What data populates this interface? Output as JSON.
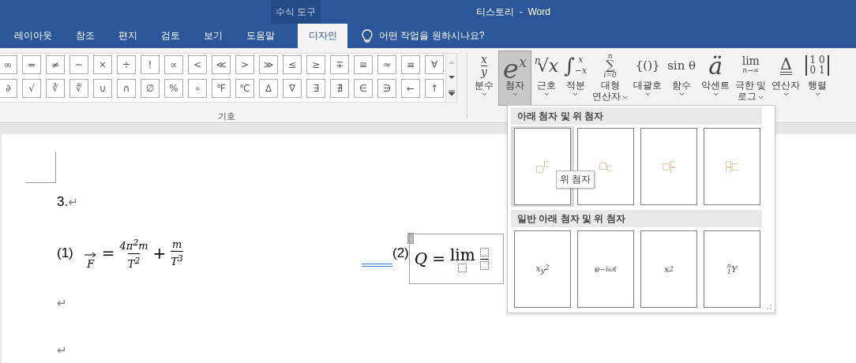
{
  "title_bar": {
    "context_group": "수식 도구",
    "title": "티스토리  -  Word"
  },
  "tabs": [
    {
      "label": "레이아웃",
      "selected": false
    },
    {
      "label": "참조",
      "selected": false
    },
    {
      "label": "편지",
      "selected": false
    },
    {
      "label": "검토",
      "selected": false
    },
    {
      "label": "보기",
      "selected": false
    },
    {
      "label": "도움말",
      "selected": false
    },
    {
      "label": "디자인",
      "selected": true
    }
  ],
  "tell_me": {
    "placeholder": "어떤 작업을 원하시나요?"
  },
  "symbols": {
    "rows": [
      [
        "∞",
        "=",
        "≠",
        "~",
        "×",
        "÷",
        "!",
        "∝",
        "<",
        "≪",
        ">",
        "≫",
        "≤",
        "≥",
        "∓",
        "≅",
        "≈",
        "≡",
        "∀"
      ],
      [
        "∂",
        "√",
        "∛",
        "∜",
        "∪",
        "∩",
        "∅",
        "%",
        "∘",
        "℉",
        "℃",
        "∆",
        "∇",
        "∃",
        "∄",
        "∈",
        "∋",
        "←",
        "↑"
      ]
    ],
    "group_label": "기호"
  },
  "structures": [
    {
      "kind": "fraction",
      "num": "x",
      "den": "y",
      "lines": [
        "분수"
      ],
      "selected": false
    },
    {
      "kind": "script",
      "base": "e",
      "sup": "x",
      "lines": [
        "첨자"
      ],
      "selected": true
    },
    {
      "kind": "radical",
      "index": "n",
      "base": "√x",
      "lines": [
        "근호"
      ],
      "selected": false
    },
    {
      "kind": "bigop",
      "sign": "∫",
      "upper": "x",
      "lower": "−x",
      "lines": [
        "적분"
      ],
      "selected": false
    },
    {
      "kind": "stack",
      "sign": "∑",
      "upper": "n",
      "lower": "i=0",
      "lines": [
        "대형",
        "연산자"
      ],
      "selected": false
    },
    {
      "kind": "text",
      "glyph": "{()}",
      "lines": [
        "대괄호"
      ],
      "selected": false
    },
    {
      "kind": "text",
      "glyph": "sin θ",
      "lines": [
        "함수"
      ],
      "selected": false
    },
    {
      "kind": "accent",
      "glyph": "ä",
      "lines": [
        "악센트"
      ],
      "selected": false
    },
    {
      "kind": "limit",
      "top": "lim",
      "bottom": "n→∞",
      "lines": [
        "극한 및",
        "로그"
      ],
      "selected": false
    },
    {
      "kind": "operator",
      "glyph": "Δ",
      "lines": [
        "연산자"
      ],
      "selected": false
    },
    {
      "kind": "matrix",
      "rows": [
        "1 0",
        "0 1"
      ],
      "lines": [
        "행렬"
      ],
      "selected": false
    }
  ],
  "document": {
    "heading": {
      "text": "3.",
      "mark": "↵"
    },
    "eq1": {
      "number": "(1)",
      "lhs": "F",
      "eq": "=",
      "frac1": {
        "num": "4π$^{2}$m",
        "den": "T$^{2}$"
      },
      "op": "+",
      "frac2": {
        "num": "m",
        "den": "T$^{3}$"
      }
    },
    "eq2": {
      "number": "(2)",
      "lhs": "Q",
      "eq": "=",
      "func": "lim"
    },
    "empty_marks": [
      "↵",
      "↵"
    ]
  },
  "dropdown": {
    "sections": [
      {
        "title": "아래 첨자 및 위 첨자",
        "tiles": [
          {
            "kind": "sup",
            "selected": true
          },
          {
            "kind": "sub",
            "selected": false
          },
          {
            "kind": "subsup",
            "selected": false
          },
          {
            "kind": "presubsup",
            "selected": false
          }
        ]
      },
      {
        "title": "일반 아래 첨자 및 위 첨자",
        "tiles": [
          {
            "kind": "math",
            "base": "x",
            "sub": "y",
            "sub_sup": "2",
            "selected": false
          },
          {
            "kind": "math",
            "base": "e",
            "sup": "−iωt",
            "selected": false
          },
          {
            "kind": "math",
            "base": "x",
            "sup": "2",
            "selected": false
          },
          {
            "kind": "math",
            "presup": "n",
            "presub": "1",
            "base": "Y",
            "selected": false
          }
        ]
      }
    ],
    "tooltip": "위 첨자"
  }
}
